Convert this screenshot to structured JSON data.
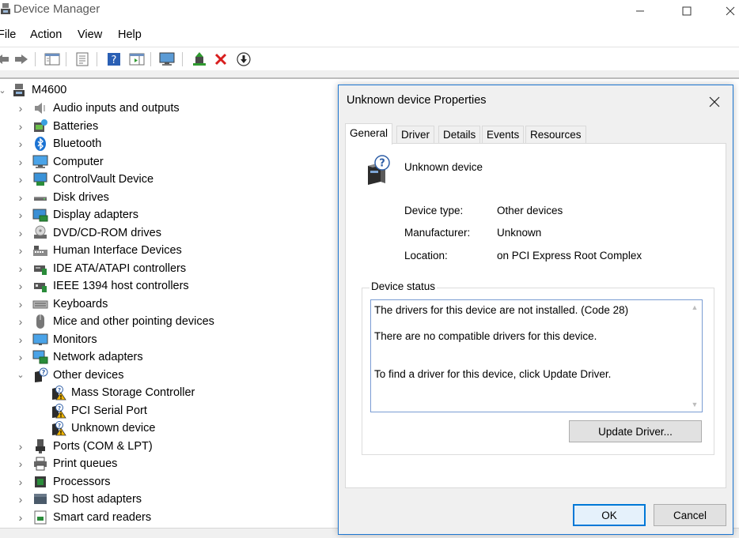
{
  "window": {
    "title": "Device Manager",
    "controls": {
      "minimize": "—",
      "maximize": "☐",
      "close": "✕"
    }
  },
  "menu": [
    "File",
    "Action",
    "View",
    "Help"
  ],
  "toolbar": {
    "buttons": [
      "back-icon",
      "forward-icon",
      "show-hide-console-tree-icon",
      "properties-icon",
      "help-icon",
      "action-pane-icon",
      "computer-monitor-icon",
      "update-driver-icon",
      "uninstall-icon",
      "download-icon"
    ]
  },
  "tree": {
    "root": "M4600",
    "items": [
      {
        "label": "Audio inputs and outputs",
        "icon": "speaker-icon"
      },
      {
        "label": "Batteries",
        "icon": "battery-icon"
      },
      {
        "label": "Bluetooth",
        "icon": "bluetooth-icon"
      },
      {
        "label": "Computer",
        "icon": "computer-icon"
      },
      {
        "label": "ControlVault Device",
        "icon": "controlvault-icon"
      },
      {
        "label": "Disk drives",
        "icon": "disk-drive-icon"
      },
      {
        "label": "Display adapters",
        "icon": "display-adapter-icon"
      },
      {
        "label": "DVD/CD-ROM drives",
        "icon": "dvd-icon"
      },
      {
        "label": "Human Interface Devices",
        "icon": "hid-icon"
      },
      {
        "label": "IDE ATA/ATAPI controllers",
        "icon": "ide-icon"
      },
      {
        "label": "IEEE 1394 host controllers",
        "icon": "ieee1394-icon"
      },
      {
        "label": "Keyboards",
        "icon": "keyboard-icon"
      },
      {
        "label": "Mice and other pointing devices",
        "icon": "mouse-icon"
      },
      {
        "label": "Monitors",
        "icon": "monitor-icon"
      },
      {
        "label": "Network adapters",
        "icon": "network-icon"
      },
      {
        "label": "Other devices",
        "icon": "other-devices-icon",
        "expanded": true
      },
      {
        "label": "Mass Storage Controller",
        "icon": "warning-device-icon",
        "child": true
      },
      {
        "label": "PCI Serial Port",
        "icon": "warning-device-icon",
        "child": true
      },
      {
        "label": "Unknown device",
        "icon": "warning-device-icon",
        "child": true
      },
      {
        "label": "Ports (COM & LPT)",
        "icon": "port-icon"
      },
      {
        "label": "Print queues",
        "icon": "printer-icon"
      },
      {
        "label": "Processors",
        "icon": "processor-icon"
      },
      {
        "label": "SD host adapters",
        "icon": "sd-icon"
      },
      {
        "label": "Smart card readers",
        "icon": "smartcard-icon"
      }
    ]
  },
  "dialog": {
    "title": "Unknown device Properties",
    "close": "✕",
    "tabs": [
      "General",
      "Driver",
      "Details",
      "Events",
      "Resources"
    ],
    "active_tab": "General",
    "device_name": "Unknown device",
    "properties": [
      {
        "label": "Device type:",
        "value": "Other devices"
      },
      {
        "label": "Manufacturer:",
        "value": "Unknown"
      },
      {
        "label": "Location:",
        "value": "on PCI Express Root Complex"
      }
    ],
    "status_group": "Device status",
    "status_lines": [
      "The drivers for this device are not installed. (Code 28)",
      "There are no compatible drivers for this device.",
      "To find a driver for this device, click Update Driver."
    ],
    "update_button": "Update Driver...",
    "ok_button": "OK",
    "cancel_button": "Cancel"
  },
  "colors": {
    "accent": "#0078d7",
    "dialog_border": "#1c76d1",
    "warning": "#f2b600"
  }
}
